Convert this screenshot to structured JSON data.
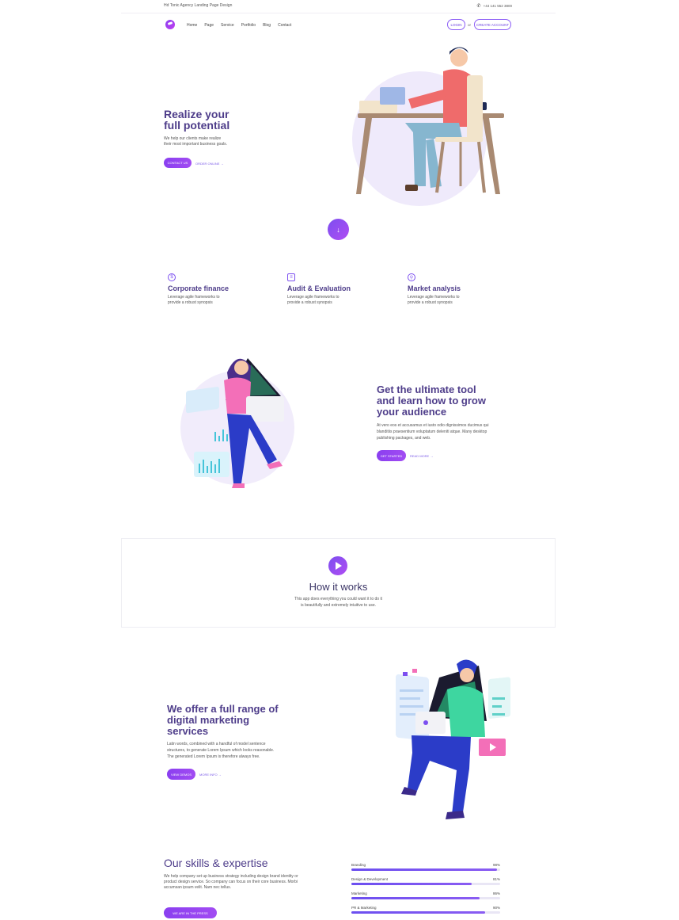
{
  "topbar": {
    "title": "Hd Tonic Agency Landing Page Design",
    "phone": "+44 141 552 3800"
  },
  "nav": {
    "items": [
      "Home",
      "Page",
      "Service",
      "Portfolio",
      "Blog",
      "Contact"
    ],
    "login": "LOGIN",
    "or": "or",
    "create": "CREATE ACCOUNT"
  },
  "hero": {
    "title_line1": "Realize your",
    "title_line2": "full potential",
    "subtitle_line1": "We help our clients make realize",
    "subtitle_line2": "their most important business goals.",
    "cta": "CONTACT US",
    "link": "ORDER ONLINE"
  },
  "features": [
    {
      "icon": "dollar-icon",
      "title": "Corporate finance",
      "desc_line1": "Leverage agile frameworks to",
      "desc_line2": "provide a robust synopsis"
    },
    {
      "icon": "clipboard-icon",
      "title": "Audit & Evaluation",
      "desc_line1": "Leverage agile frameworks to",
      "desc_line2": "provide a robust synopsis"
    },
    {
      "icon": "search-icon",
      "title": "Market analysis",
      "desc_line1": "Leverage agile frameworks to",
      "desc_line2": "provide a robust synopsis"
    }
  ],
  "section2": {
    "title_line1": "Get the ultimate tool",
    "title_line2": "and learn how to grow",
    "title_line3": "your audience",
    "p_line1": "At vero eos et accusamus et iusto odio dignissimos ducimus qui",
    "p_line2": "blanditiis praesentium voluptatum deleniti atque. Many desktop",
    "p_line3": "publishing packages, and web.",
    "cta": "GET STARTED",
    "link": "READ MORE"
  },
  "how": {
    "title": "How it works",
    "p_line1": "This app does everything you could want it to do it",
    "p_line2": "is beautifully and extremely intuitive to use."
  },
  "section3": {
    "title_line1": "We offer a full range of",
    "title_line2": "digital marketing",
    "title_line3": "services",
    "p_line1": "Latin words, combined with a handful of model sentence",
    "p_line2": "structures, to generate Lorem Ipsum which looks reasonable.",
    "p_line3": "The generated Lorem Ipsum is therefore always free.",
    "cta": "VIEW DEMOS",
    "link": "MORE INFO"
  },
  "skills": {
    "title": "Our skills & expertise",
    "p_line1": "We help company set up business strategy including design brand identity or",
    "p_line2": "product design service. So company can focus on their core business. Morbi",
    "p_line3": "accumsan ipsum velit. Nam nec tellus.",
    "cta": "WE ARE IN THE PRESS",
    "items": [
      {
        "label": "Branding",
        "pct_text": "98%",
        "value": 0.98
      },
      {
        "label": "Design & Development",
        "pct_text": "81%",
        "value": 0.81
      },
      {
        "label": "Marketing",
        "pct_text": "86%",
        "value": 0.86
      },
      {
        "label": "PR & Marketing",
        "pct_text": "90%",
        "value": 0.9
      }
    ]
  }
}
